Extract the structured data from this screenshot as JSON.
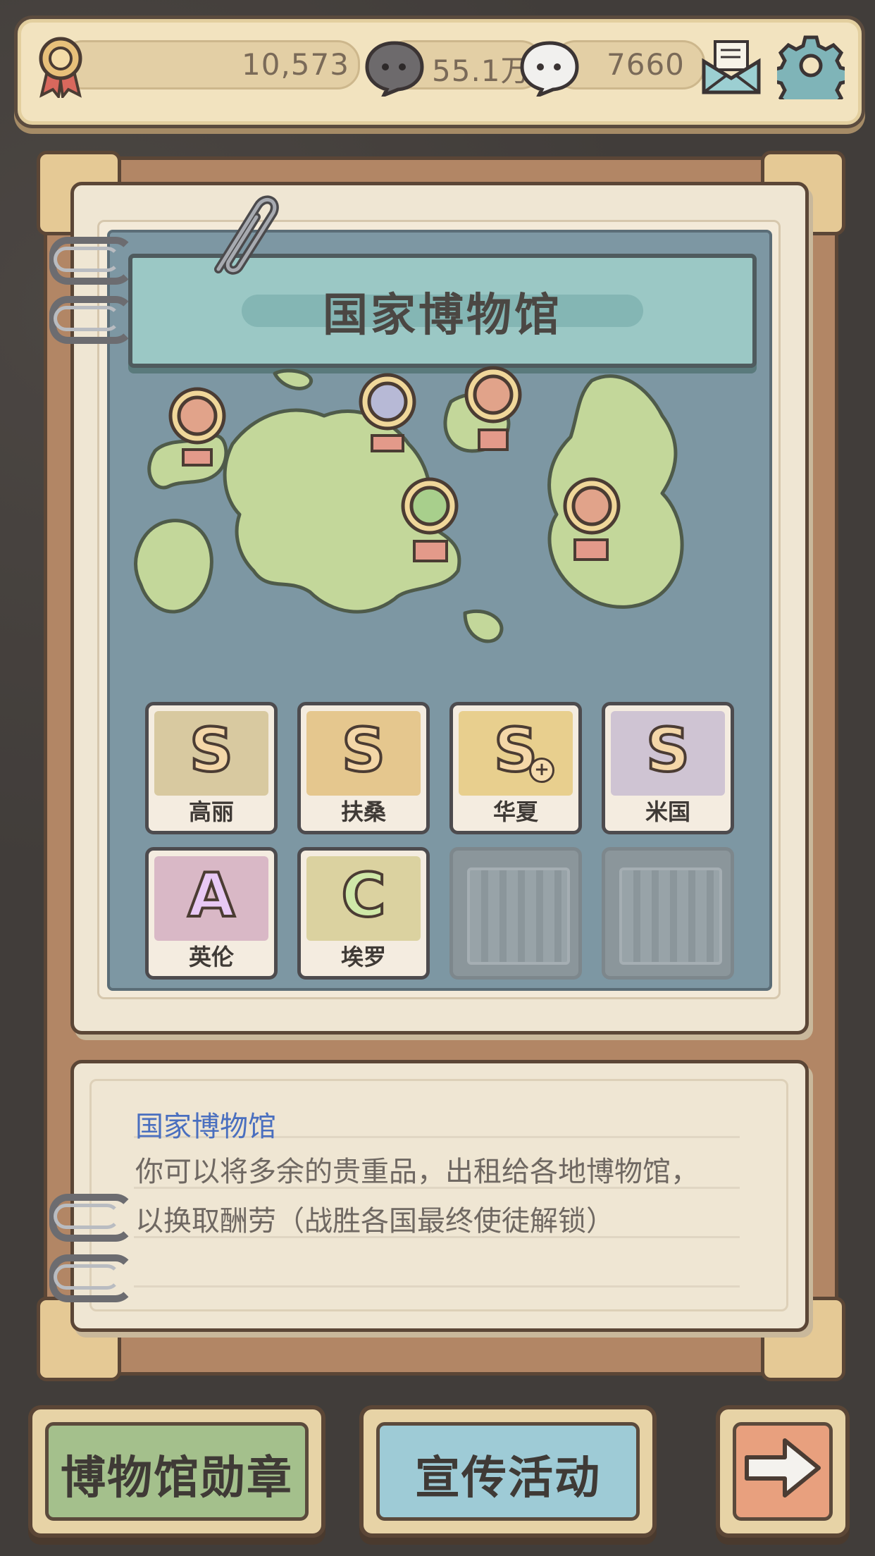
{
  "topbar": {
    "medals": "10,573",
    "dark_bubbles": "55.1万",
    "light_bubbles": "7660",
    "icons": [
      "medal-icon",
      "dark-bubble-icon",
      "light-bubble-icon",
      "mail-icon",
      "gear-icon"
    ]
  },
  "title": "国家博物馆",
  "cards": [
    {
      "label": "高丽",
      "grade": "S",
      "color": "#f4d7a8",
      "bg": "#d8c9a0",
      "locked": false,
      "plus": false
    },
    {
      "label": "扶桑",
      "grade": "S",
      "color": "#f4d7a8",
      "bg": "#e5c78e",
      "locked": false,
      "plus": false
    },
    {
      "label": "华夏",
      "grade": "S",
      "color": "#f4d7a8",
      "bg": "#e8cf8e",
      "locked": false,
      "plus": true
    },
    {
      "label": "米国",
      "grade": "S",
      "color": "#f4d7a8",
      "bg": "#cfc4d3",
      "locked": false,
      "plus": false
    },
    {
      "label": "英伦",
      "grade": "A",
      "color": "#e8c9f4",
      "bg": "#d9b8c6",
      "locked": false,
      "plus": false
    },
    {
      "label": "埃罗",
      "grade": "C",
      "color": "#cfe8a8",
      "bg": "#dbd2a0",
      "locked": false,
      "plus": false
    },
    {
      "label": "",
      "grade": "",
      "color": "",
      "bg": "",
      "locked": true,
      "plus": false
    },
    {
      "label": "",
      "grade": "",
      "color": "",
      "bg": "",
      "locked": true,
      "plus": false
    }
  ],
  "description": {
    "title": "国家博物馆",
    "line1": "你可以将多余的贵重品，出租给各地博物馆，",
    "line2": "以换取酬劳（战胜各国最终使徒解锁）"
  },
  "buttons": {
    "medal": "博物馆勋章",
    "promo": "宣传活动",
    "next_icon": "arrow-right-icon"
  },
  "colors": {
    "map_water": "#7d97a3",
    "land": "#c3d79a",
    "banner": "#9bc8c5",
    "desc_title": "#4a6fbf"
  }
}
